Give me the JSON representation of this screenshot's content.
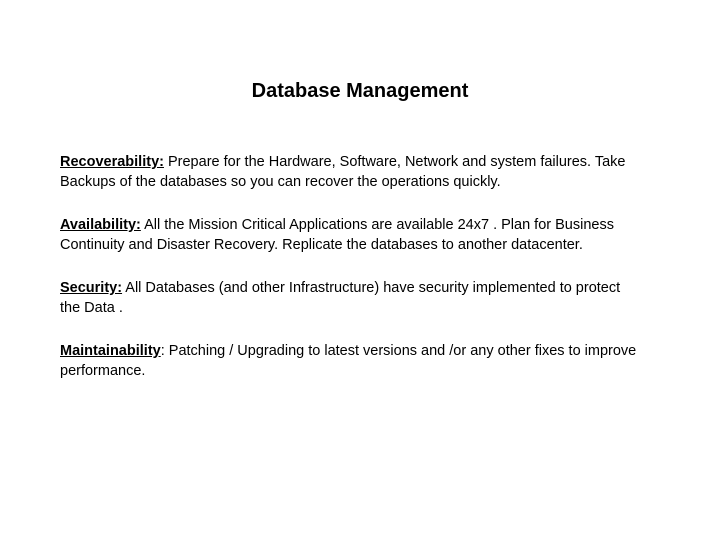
{
  "title": "Database Management",
  "sections": [
    {
      "heading": "Recoverability:",
      "body": " Prepare for the Hardware, Software, Network and system failures. Take Backups of the databases so you can recover the operations quickly."
    },
    {
      "heading": "Availability:",
      "body": " All the Mission Critical Applications are available 24x7 . Plan for Business Continuity and Disaster Recovery. Replicate the databases to another datacenter."
    },
    {
      "heading": "Security:",
      "body": " All Databases (and other Infrastructure) have security implemented to protect the Data ."
    },
    {
      "heading": "Maintainability",
      "body": ": Patching / Upgrading to latest versions and /or any other fixes to improve performance."
    }
  ]
}
